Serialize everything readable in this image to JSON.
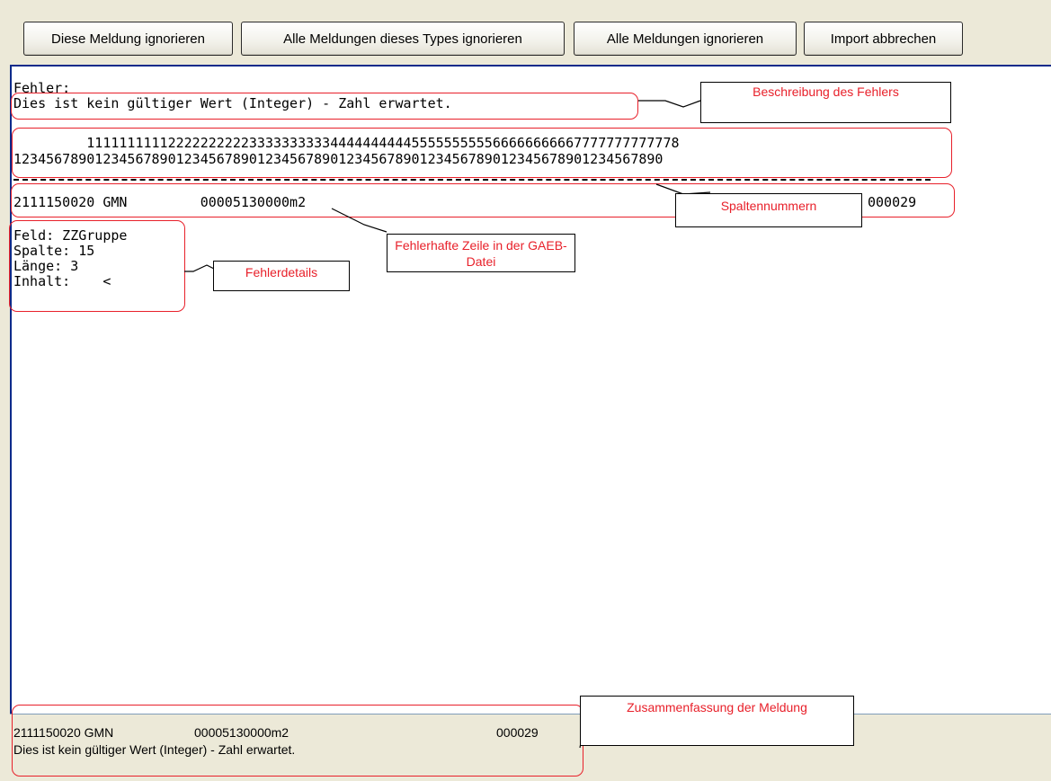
{
  "toolbar": {
    "ignore_message": "Diese Meldung ignorieren",
    "ignore_type": "Alle Meldungen dieses Types ignorieren",
    "ignore_all": "Alle Meldungen ignorieren",
    "cancel_import": "Import abbrechen"
  },
  "error": {
    "heading": "Fehler:",
    "description": "Dies ist kein gültiger Wert (Integer) - Zahl erwartet."
  },
  "ruler": {
    "tens": "         1111111111222222222233333333334444444444555555555566666666667777777777778",
    "units": "12345678901234567890123456789012345678901234567890123456789012345678901234567890"
  },
  "faulty_line": {
    "left": "2111150020 GMN         00005130000m2",
    "right": "000029"
  },
  "details": {
    "field": "Feld: ZZGruppe",
    "column": "Spalte: 15",
    "length": "Länge: 3",
    "content": "Inhalt:    <"
  },
  "annotations": {
    "description": "Beschreibung des Fehlers",
    "column_numbers": "Spaltennummern",
    "faulty_line": "Fehlerhafte Zeile in der GAEB-Datei",
    "details": "Fehlerdetails",
    "summary": "Zusammenfassung der Meldung"
  },
  "summary": {
    "line_code": "2111150020 GMN",
    "line_value": "00005130000m2",
    "line_number": "000029",
    "message": "Dies ist kein gültiger Wert (Integer) - Zahl erwartet."
  },
  "colors": {
    "annotation_red": "#E8202A",
    "panel_border": "#0A2A8A",
    "window_bg": "#ECE9D8"
  }
}
